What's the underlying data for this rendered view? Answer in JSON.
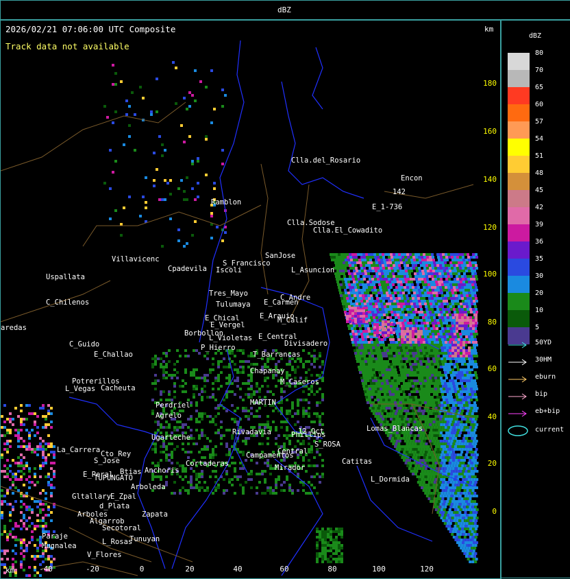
{
  "header": {
    "title": "dBZ"
  },
  "map": {
    "timestamp": "2026/02/21 07:06:00 UTC Composite",
    "track_note": "Track data not available",
    "y_unit": "km",
    "x_unit": "km",
    "y_ticks": [
      "180",
      "160",
      "140",
      "120",
      "100",
      "80",
      "60",
      "40",
      "20",
      "0"
    ],
    "x_ticks": [
      "-40",
      "-20",
      "0",
      "20",
      "40",
      "60",
      "80",
      "100",
      "120"
    ],
    "places": [
      "Clla.del_Rosario",
      "Encon",
      "142",
      "E_1-736",
      "Ramblon",
      "Clla.Sodose",
      "Clla.El_Cowadito",
      "S_Francisco",
      "SanJose",
      "L_Asuncion",
      "Uspallata",
      "Villavicenc",
      "Cpadevila",
      "Iscoli",
      "Tres_Mayo",
      "Tulumaya",
      "E_Carmen",
      "C_Andre",
      "C_Chilenos",
      "E_Chical",
      "E_Vergel",
      "E_Arauio",
      "M_Calif",
      "aredas",
      "Borbollon",
      "L_Violetas",
      "E_Central",
      "Divisadero",
      "C_Guido",
      "E_Challao",
      "P_Hierro",
      "T_Barrancas",
      "Chapanay",
      "M_Caseros",
      "Potrerillos",
      "Cacheuta",
      "L_Vegas",
      "MARTIN",
      "Perdriel",
      "Agrelo",
      "Ugarteche",
      "Rivadavia",
      "Phillips",
      "S_ROSA",
      "Lomas_Blancas",
      "La_Carrera",
      "Cto_Rey",
      "S_Jose",
      "E_Peral",
      "Btias",
      "Anchoris",
      "TUPUNGATO",
      "Arboleda",
      "Cortaderas",
      "Campamentos",
      "Central",
      "12_Oct",
      "Catitas",
      "Mirador",
      "L_Dormida",
      "Gltallary",
      "E_Zpal",
      "d_Plata",
      "Arboles",
      "Zapata",
      "Algarrob",
      "Tunuyan",
      "L_Rosas",
      "V_Flores",
      "Secotoral",
      "Paraje",
      "Mugnalea"
    ]
  },
  "legend": {
    "unit": "dBZ",
    "levels": [
      {
        "label": "80",
        "color": "#d8d8d8"
      },
      {
        "label": "70",
        "color": "#b8b8b8"
      },
      {
        "label": "65",
        "color": "#ff3a22"
      },
      {
        "label": "60",
        "color": "#ff6a10"
      },
      {
        "label": "57",
        "color": "#ff9a55"
      },
      {
        "label": "54",
        "color": "#ffff00"
      },
      {
        "label": "51",
        "color": "#ffcc33"
      },
      {
        "label": "48",
        "color": "#d4903a"
      },
      {
        "label": "45",
        "color": "#cc7a88"
      },
      {
        "label": "42",
        "color": "#e06aa8"
      },
      {
        "label": "39",
        "color": "#cc1aa0"
      },
      {
        "label": "36",
        "color": "#6a1acc"
      },
      {
        "label": "35",
        "color": "#2a4ae0"
      },
      {
        "label": "30",
        "color": "#1a8ae0"
      },
      {
        "label": "20",
        "color": "#1a8a1a"
      },
      {
        "label": "10",
        "color": "#0a5a0a"
      },
      {
        "label": "5",
        "color": "#4a3a90"
      }
    ],
    "tracks": [
      {
        "label": "50YD",
        "color": "#40e0e0"
      },
      {
        "label": "30HM",
        "color": "#ffffff"
      },
      {
        "label": "eburn",
        "color": "#ffcc66"
      },
      {
        "label": "bip",
        "color": "#ffaad0"
      },
      {
        "label": "eb+bip",
        "color": "#ff44ff"
      }
    ],
    "current": {
      "label": "current",
      "color": "#40e0e0"
    }
  }
}
